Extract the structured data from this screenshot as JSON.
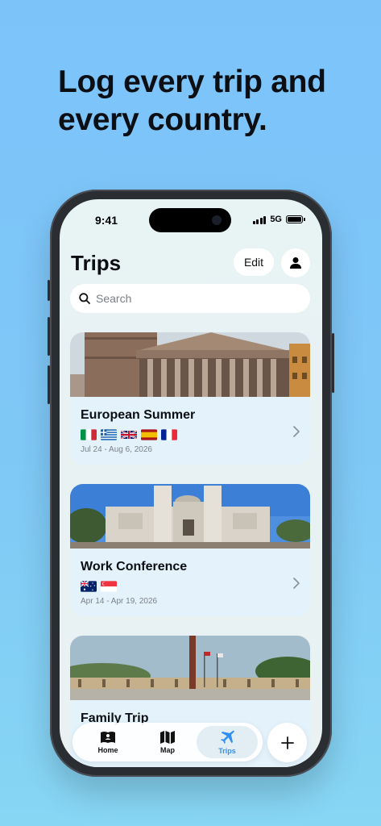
{
  "headline": {
    "line1": "Log every trip and",
    "line2": "every country."
  },
  "status_bar": {
    "time": "9:41",
    "network": "5G"
  },
  "header": {
    "title": "Trips",
    "edit_label": "Edit",
    "profile_icon": "person-icon"
  },
  "search": {
    "placeholder": "Search"
  },
  "trips": [
    {
      "name": "European Summer",
      "dates": "Jul 24 - Aug 6, 2026",
      "flags": [
        "Italy",
        "Greece",
        "United Kingdom",
        "Spain",
        "France"
      ]
    },
    {
      "name": "Work Conference",
      "dates": "Apr 14 - Apr 19, 2026",
      "flags": [
        "Australia",
        "Singapore"
      ]
    },
    {
      "name": "Family Trip",
      "dates": "",
      "flags": []
    }
  ],
  "tab_bar": {
    "tabs": [
      {
        "label": "Home",
        "icon": "book-person-icon"
      },
      {
        "label": "Map",
        "icon": "map-icon"
      },
      {
        "label": "Trips",
        "icon": "airplane-icon",
        "active": true
      }
    ],
    "add_icon": "plus-icon"
  },
  "colors": {
    "accent": "#2f8ff2",
    "background": "#7cc3fa"
  }
}
